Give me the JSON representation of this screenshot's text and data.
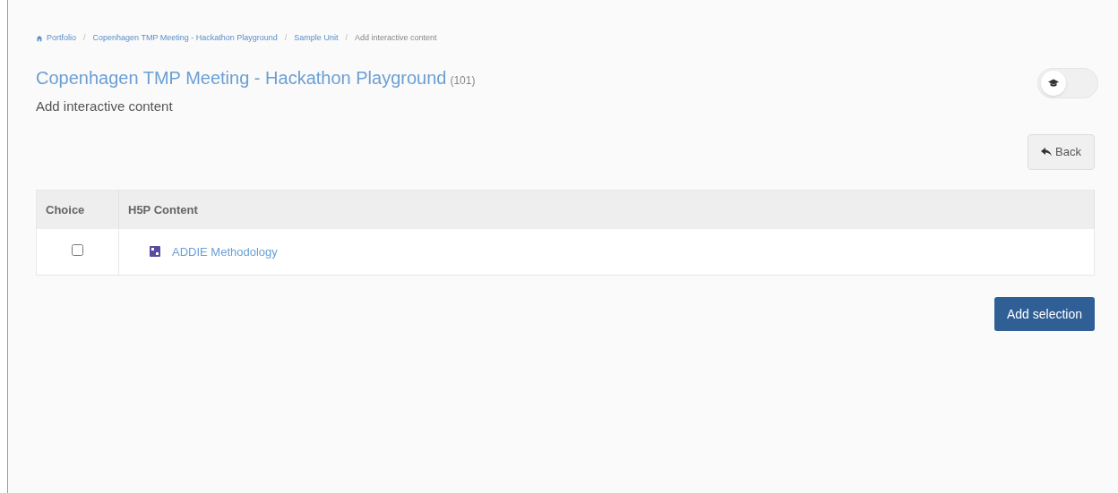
{
  "breadcrumb": [
    {
      "label": "Portfolio",
      "kind": "home"
    },
    {
      "label": "Copenhagen TMP Meeting - Hackathon Playground",
      "kind": "link"
    },
    {
      "label": "Sample Unit",
      "kind": "link"
    },
    {
      "label": "Add interactive content",
      "kind": "current"
    }
  ],
  "separator": "/",
  "title": "Copenhagen TMP Meeting - Hackathon Playground",
  "count": "(101)",
  "subtitle": "Add interactive content",
  "teacher_toggle": {
    "on": false
  },
  "back_button": "Back",
  "table": {
    "columns": [
      "Choice",
      "H5P Content"
    ],
    "rows": [
      {
        "checked": false,
        "content": "ADDIE Methodology"
      }
    ]
  },
  "submit_button": "Add selection"
}
